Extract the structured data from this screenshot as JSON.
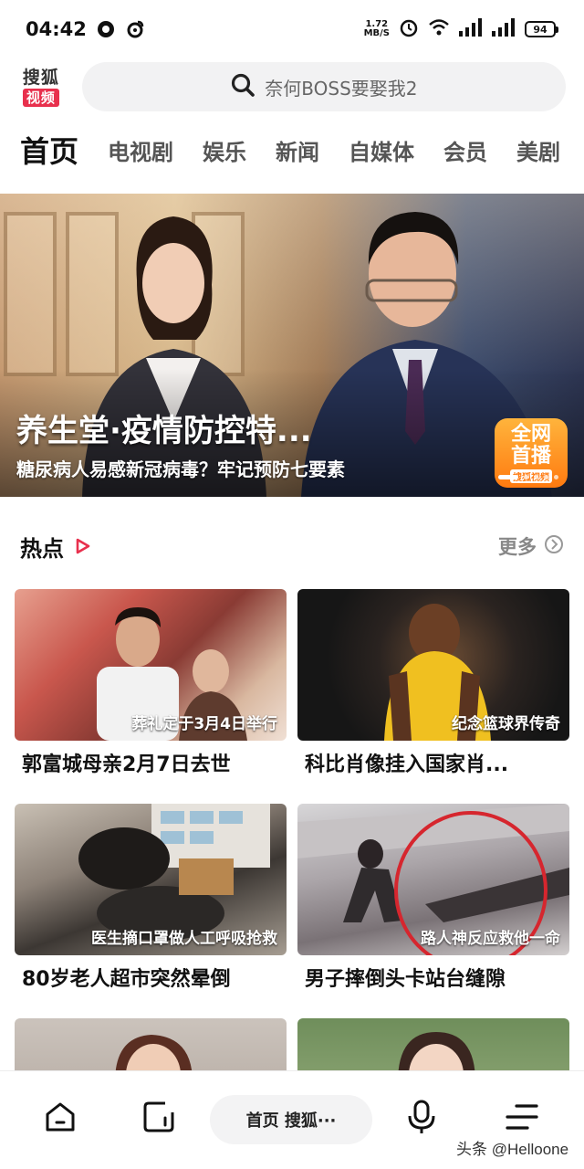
{
  "status_bar": {
    "time": "04:42",
    "speed_value": "1.72",
    "speed_unit": "MB/S",
    "battery": "94"
  },
  "header": {
    "logo_top": "搜狐",
    "logo_bottom": "视频",
    "search_placeholder": "奈何BOSS要娶我2"
  },
  "tabs": [
    {
      "label": "首页",
      "active": true
    },
    {
      "label": "电视剧"
    },
    {
      "label": "娱乐"
    },
    {
      "label": "新闻"
    },
    {
      "label": "自媒体"
    },
    {
      "label": "会员"
    },
    {
      "label": "美剧"
    }
  ],
  "banner": {
    "title": "养生堂·疫情防控特...",
    "subtitle": "糖尿病人易感新冠病毒？牢记预防七要素",
    "badge_line1": "全网",
    "badge_line2": "首播",
    "badge_line3": "搜狐视频",
    "page_count": 5,
    "active_page": 1
  },
  "section": {
    "title": "热点",
    "more_label": "更多"
  },
  "cards": [
    {
      "caption": "葬礼定于3月4日举行",
      "title": "郭富城母亲2月7日去世"
    },
    {
      "caption": "纪念篮球界传奇",
      "title": "科比肖像挂入国家肖..."
    },
    {
      "caption": "医生摘口罩做人工呼吸抢救",
      "title": "80岁老人超市突然晕倒"
    },
    {
      "caption": "路人神反应救他一命",
      "title": "男子摔倒头卡站台缝隙"
    },
    {
      "caption": "",
      "title": ""
    },
    {
      "caption": "",
      "title": ""
    }
  ],
  "bottom_nav": {
    "home_icon": "home-icon",
    "channel_icon": "channel-icon",
    "pill_label": "首页 搜狐···",
    "voice_icon": "mic-icon",
    "menu_icon": "menu-icon"
  },
  "watermark": "头条 @Helloone",
  "colors": {
    "brand_red": "#e8304d",
    "search_bg": "#f2f2f3",
    "badge_orange": "#ff7a10"
  }
}
